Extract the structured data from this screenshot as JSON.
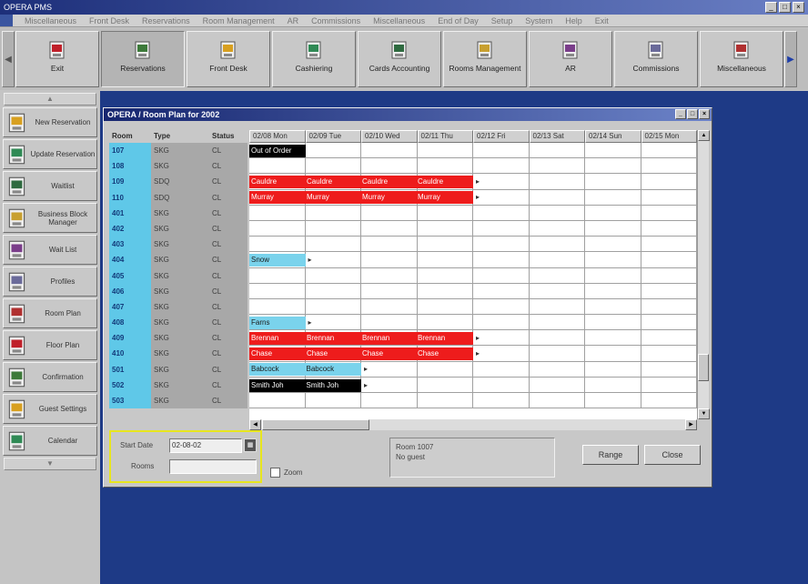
{
  "app": {
    "title": "OPERA PMS",
    "menu": [
      "Miscellaneous",
      "Front Desk",
      "Reservations",
      "Room Management",
      "AR",
      "Commissions",
      "Miscellaneous",
      "End of Day",
      "Setup",
      "System",
      "Help",
      "Exit"
    ]
  },
  "toolbar": {
    "buttons": [
      {
        "label": "Exit",
        "icon": "exit-door-icon"
      },
      {
        "label": "Reservations",
        "icon": "reservations-icon"
      },
      {
        "label": "Front Desk",
        "icon": "front-desk-icon"
      },
      {
        "label": "Cashiering",
        "icon": "cashiering-icon"
      },
      {
        "label": "Cards Accounting",
        "icon": "cards-icon"
      },
      {
        "label": "Rooms Management",
        "icon": "rooms-icon"
      },
      {
        "label": "AR",
        "icon": "ar-icon"
      },
      {
        "label": "Commissions",
        "icon": "commissions-icon"
      },
      {
        "label": "Miscellaneous",
        "icon": "misc-icon"
      }
    ]
  },
  "sidebar": {
    "items": [
      {
        "label": "New Reservation"
      },
      {
        "label": "Update Reservation"
      },
      {
        "label": "Waitlist"
      },
      {
        "label": "Business Block Manager"
      },
      {
        "label": "Wait List"
      },
      {
        "label": "Profiles"
      },
      {
        "label": "Room Plan"
      },
      {
        "label": "Floor Plan"
      },
      {
        "label": "Confirmation"
      },
      {
        "label": "Guest Settings"
      },
      {
        "label": "Calendar"
      }
    ]
  },
  "plan_window": {
    "title": "OPERA / Room Plan for 2002",
    "headers": {
      "room": "Room",
      "type": "Type",
      "status": "Status"
    },
    "dates": [
      "02/08 Mon",
      "02/09 Tue",
      "02/10 Wed",
      "02/11 Thu",
      "02/12 Fri",
      "02/13 Sat",
      "02/14 Sun",
      "02/15 Mon"
    ],
    "rooms": [
      {
        "room": "107",
        "type": "SKG",
        "status": "CL"
      },
      {
        "room": "108",
        "type": "SKG",
        "status": "CL"
      },
      {
        "room": "109",
        "type": "SDQ",
        "status": "CL"
      },
      {
        "room": "110",
        "type": "SDQ",
        "status": "CL"
      },
      {
        "room": "401",
        "type": "SKG",
        "status": "CL"
      },
      {
        "room": "402",
        "type": "SKG",
        "status": "CL"
      },
      {
        "room": "403",
        "type": "SKG",
        "status": "CL"
      },
      {
        "room": "404",
        "type": "SKG",
        "status": "CL"
      },
      {
        "room": "405",
        "type": "SKG",
        "status": "CL"
      },
      {
        "room": "406",
        "type": "SKG",
        "status": "CL"
      },
      {
        "room": "407",
        "type": "SKG",
        "status": "CL"
      },
      {
        "room": "408",
        "type": "SKG",
        "status": "CL"
      },
      {
        "room": "409",
        "type": "SKG",
        "status": "CL"
      },
      {
        "room": "410",
        "type": "SKG",
        "status": "CL"
      },
      {
        "room": "501",
        "type": "SKG",
        "status": "CL"
      },
      {
        "room": "502",
        "type": "SKG",
        "status": "CL"
      },
      {
        "room": "503",
        "type": "SKG",
        "status": "CL"
      }
    ],
    "bookings": [
      {
        "row": 0,
        "start": 0,
        "span": 1,
        "color": "black",
        "cells": [
          "Out of Order"
        ]
      },
      {
        "row": 2,
        "start": 0,
        "span": 4,
        "color": "red",
        "cells": [
          "Cauldre",
          "Cauldre",
          "Cauldre",
          "Cauldre"
        ]
      },
      {
        "row": 3,
        "start": 0,
        "span": 4,
        "color": "red",
        "cells": [
          "Murray",
          "Murray",
          "Murray",
          "Murray"
        ]
      },
      {
        "row": 7,
        "start": 0,
        "span": 1,
        "color": "cyan",
        "cells": [
          "Snow"
        ]
      },
      {
        "row": 11,
        "start": 0,
        "span": 1,
        "color": "cyan",
        "cells": [
          "Farns"
        ]
      },
      {
        "row": 12,
        "start": 0,
        "span": 4,
        "color": "red",
        "cells": [
          "Brennan",
          "Brennan",
          "Brennan",
          "Brennan"
        ]
      },
      {
        "row": 13,
        "start": 0,
        "span": 4,
        "color": "red",
        "cells": [
          "Chase",
          "Chase",
          "Chase",
          "Chase"
        ]
      },
      {
        "row": 14,
        "start": 0,
        "span": 2,
        "color": "cyan",
        "cells": [
          "Babcock",
          "Babcock"
        ]
      },
      {
        "row": 15,
        "start": 0,
        "span": 2,
        "color": "black",
        "cells": [
          "Smith Joh",
          "Smith Joh"
        ]
      }
    ],
    "footer": {
      "start_date_label": "Start Date",
      "start_date_value": "02-08-02",
      "rooms_label": "Rooms",
      "rooms_value": "",
      "check_label": "Zoom",
      "info_line1": "Room 1007",
      "info_line2": "No guest",
      "range_button": "Range",
      "close_button": "Close"
    }
  }
}
